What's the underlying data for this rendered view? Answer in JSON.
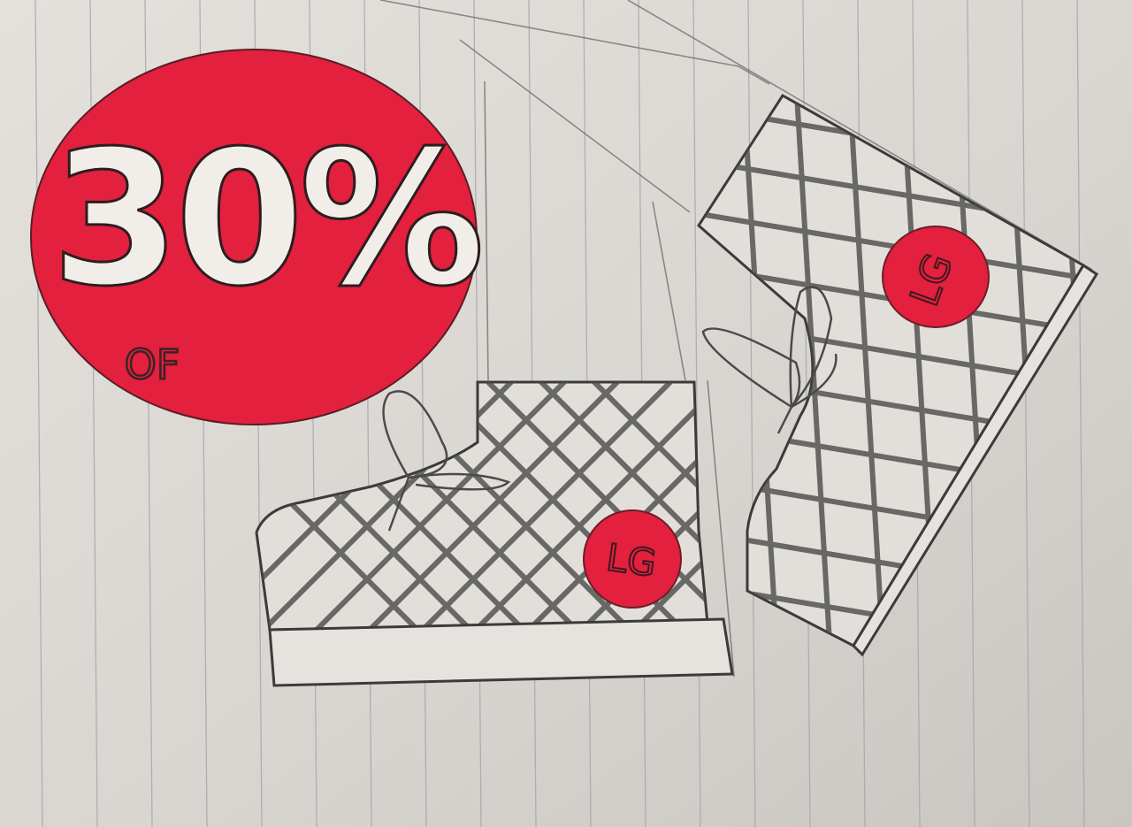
{
  "sketch": {
    "badge": {
      "percent": "30%",
      "suffix": "OF"
    },
    "logo_text": "LG",
    "colors": {
      "paper": "#dcd9d4",
      "paper_light": "#e6e3de",
      "ruling": "#a9a9b0",
      "accent_red": "#e3203e",
      "pencil": "#3b3b3b"
    }
  }
}
